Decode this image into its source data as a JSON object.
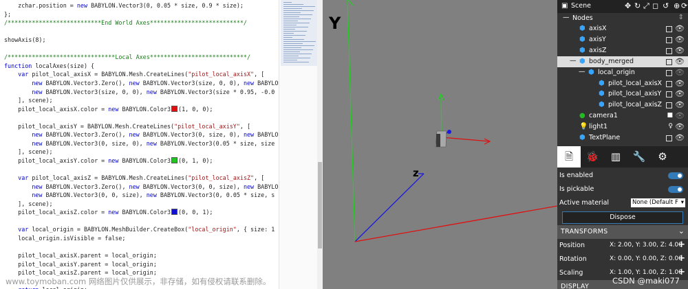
{
  "editor": {
    "lines": [
      {
        "text": "    zchar.position = new BABYLON.Vector3(0, 0.05 * size, 0.9 * size);",
        "kind": "code"
      },
      {
        "text": "};",
        "kind": "code"
      },
      {
        "text": "/***************************End World Axes***************************/",
        "kind": "comment"
      },
      {
        "text": "",
        "kind": "code"
      },
      {
        "text": "showAxis(8);",
        "kind": "code"
      },
      {
        "text": "",
        "kind": "code"
      },
      {
        "text": "/*******************************Local Axes****************************/",
        "kind": "comment"
      },
      {
        "text": "function localAxes(size) {",
        "kind": "code"
      },
      {
        "text": "    var pilot_local_axisX = BABYLON.Mesh.CreateLines(\"pilot_local_axisX\", [",
        "kind": "code"
      },
      {
        "text": "        new BABYLON.Vector3.Zero(), new BABYLON.Vector3(size, 0, 0), new BABYLON",
        "kind": "code"
      },
      {
        "text": "        new BABYLON.Vector3(size, 0, 0), new BABYLON.Vector3(size * 0.95, -0.0",
        "kind": "code"
      },
      {
        "text": "    ], scene);",
        "kind": "code"
      },
      {
        "text": "    pilot_local_axisX.color = new BABYLON.Color3",
        "kind": "code",
        "swatch": "#e01010",
        "after": "(1, 0, 0);"
      },
      {
        "text": "",
        "kind": "code"
      },
      {
        "text": "    pilot_local_axisY = BABYLON.Mesh.CreateLines(\"pilot_local_axisY\", [",
        "kind": "code"
      },
      {
        "text": "        new BABYLON.Vector3.Zero(), new BABYLON.Vector3(0, size, 0), new BABYLO",
        "kind": "code"
      },
      {
        "text": "        new BABYLON.Vector3(0, size, 0), new BABYLON.Vector3(0.05 * size, size",
        "kind": "code"
      },
      {
        "text": "    ], scene);",
        "kind": "code"
      },
      {
        "text": "    pilot_local_axisY.color = new BABYLON.Color3",
        "kind": "code",
        "swatch": "#22c422",
        "after": "(0, 1, 0);"
      },
      {
        "text": "",
        "kind": "code"
      },
      {
        "text": "    var pilot_local_axisZ = BABYLON.Mesh.CreateLines(\"pilot_local_axisZ\", [",
        "kind": "code"
      },
      {
        "text": "        new BABYLON.Vector3.Zero(), new BABYLON.Vector3(0, 0, size), new BABYLO",
        "kind": "code"
      },
      {
        "text": "        new BABYLON.Vector3(0, 0, size), new BABYLON.Vector3(0, 0.05 * size, s",
        "kind": "code"
      },
      {
        "text": "    ], scene);",
        "kind": "code"
      },
      {
        "text": "    pilot_local_axisZ.color = new BABYLON.Color3",
        "kind": "code",
        "swatch": "#1010d0",
        "after": "(0, 0, 1);"
      },
      {
        "text": "",
        "kind": "code"
      },
      {
        "text": "    var local_origin = BABYLON.MeshBuilder.CreateBox(\"local_origin\", { size: 1",
        "kind": "code"
      },
      {
        "text": "    local_origin.isVisible = false;",
        "kind": "code"
      },
      {
        "text": "",
        "kind": "code"
      },
      {
        "text": "    pilot_local_axisX.parent = local_origin;",
        "kind": "code"
      },
      {
        "text": "    pilot_local_axisY.parent = local_origin;",
        "kind": "code"
      },
      {
        "text": "    pilot_local_axisZ.parent = local_origin;",
        "kind": "code"
      },
      {
        "text": "",
        "kind": "code"
      },
      {
        "text": "    return local_origin;",
        "kind": "code"
      }
    ]
  },
  "watermark": "www.toymoban.com 网络图片仅供展示，非存储，如有侵权请联系删除。",
  "viewport": {
    "label_y": "Y",
    "label_z": "z",
    "colors": {
      "x_axis": "#e01010",
      "y_axis": "#1fd01f",
      "z_axis": "#1a1ae0",
      "background": "#808080"
    }
  },
  "inspector": {
    "scene_label": "Scene",
    "nodes_label": "Nodes",
    "tree": [
      {
        "label": "axisX",
        "indent": 1,
        "icon": "cube-icon",
        "check": true,
        "eye": true
      },
      {
        "label": "axisY",
        "indent": 1,
        "icon": "cube-icon",
        "check": true,
        "eye": true
      },
      {
        "label": "axisZ",
        "indent": 1,
        "icon": "cube-icon",
        "check": true,
        "eye": true
      },
      {
        "label": "body_merged",
        "indent": 1,
        "icon": "cube-icon",
        "check": true,
        "eye": true,
        "selected": true,
        "expander": "—"
      },
      {
        "label": "local_origin",
        "indent": 2,
        "icon": "cube-icon",
        "check": true,
        "eye": true,
        "expander": "—",
        "eye_dim": true
      },
      {
        "label": "pilot_local_axisX",
        "indent": 3,
        "icon": "cube-icon",
        "check": true,
        "eye": true
      },
      {
        "label": "pilot_local_axisY",
        "indent": 3,
        "icon": "cube-icon",
        "check": true,
        "eye": true
      },
      {
        "label": "pilot_local_axisZ",
        "indent": 3,
        "icon": "cube-icon",
        "check": true,
        "eye": true
      },
      {
        "label": "camera1",
        "indent": 1,
        "icon": "camera-icon",
        "check": false,
        "eye": true,
        "eye_dim": true
      },
      {
        "label": "light1",
        "indent": 1,
        "icon": "light-icon",
        "check": false,
        "eye": true
      },
      {
        "label": "TextPlane",
        "indent": 1,
        "icon": "cube-icon",
        "check": true,
        "eye": true
      }
    ],
    "tabs": [
      "properties-tab",
      "debug-tab",
      "statistics-tab",
      "tools-tab",
      "settings-tab"
    ],
    "props": {
      "is_enabled": "Is enabled",
      "is_pickable": "Is pickable",
      "active_material": "Active material",
      "active_material_value": "None (Default F",
      "dispose": "Dispose",
      "transforms_header": "TRANSFORMS",
      "position_label": "Position",
      "position_value": "X: 2.00, Y: 3.00, Z: 4.00",
      "rotation_label": "Rotation",
      "rotation_value": "X: 0.00, Y: 0.00, Z: 0.00",
      "scaling_label": "Scaling",
      "scaling_value": "X: 1.00, Y: 1.00, Z: 1.00",
      "display_header": "DISPLAY"
    }
  },
  "csdn_watermark": "CSDN @maki077"
}
